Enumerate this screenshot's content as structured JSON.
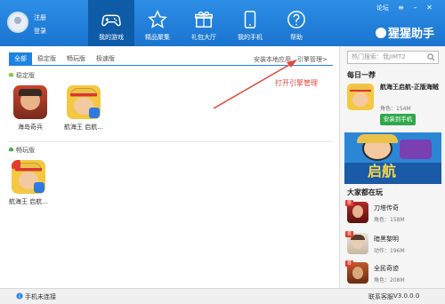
{
  "user": {
    "register": "注册",
    "login": "登录"
  },
  "nav": [
    {
      "label": "我的游戏",
      "icon": "gamepad-icon"
    },
    {
      "label": "精品聚集",
      "icon": "star-icon"
    },
    {
      "label": "礼包大厅",
      "icon": "gift-icon"
    },
    {
      "label": "我的手机",
      "icon": "phone-icon"
    },
    {
      "label": "帮助",
      "icon": "help-icon"
    }
  ],
  "top_links": {
    "forum": "论坛"
  },
  "brand": "猩猩助手",
  "tabs": [
    "全部",
    "稳定版",
    "畅玩版",
    "极速版"
  ],
  "right_links": {
    "install_local": "安装本地应用",
    "engine_manage": "引擎管理>"
  },
  "sections": {
    "stable": {
      "title": "稳定版",
      "apps": [
        {
          "name": "海岛奇兵"
        },
        {
          "name": "航海王 启航..."
        }
      ]
    },
    "smooth": {
      "title": "畅玩版",
      "apps": [
        {
          "name": "航海王 启航..."
        }
      ]
    }
  },
  "annotation": "打开引擎管理",
  "sidebar": {
    "search_placeholder": "热门搜索：我jIMT2",
    "daily_title": "每日一荐",
    "daily": {
      "name": "航海王启航-正版海贼",
      "meta": "角色：154M",
      "button": "安装到手机"
    },
    "banner_text": "启航",
    "popular_title": "大家都在玩",
    "popular": [
      {
        "tag": "首",
        "name": "刀塔传奇",
        "meta": "角色：158M"
      },
      {
        "tag": "首",
        "name": "暗黑黎明",
        "meta": "动作：196M"
      },
      {
        "tag": "首",
        "name": "全民奇迹",
        "meta": "角色：208M"
      }
    ]
  },
  "status": {
    "phone": "手机未连接",
    "feedback": "联系客服",
    "version": "V3.0.0.0"
  },
  "colors": {
    "topbar": "#1f7fd9",
    "accent": "#1c83e0",
    "annotation": "#e2463a",
    "install_button": "#2fa84a"
  }
}
